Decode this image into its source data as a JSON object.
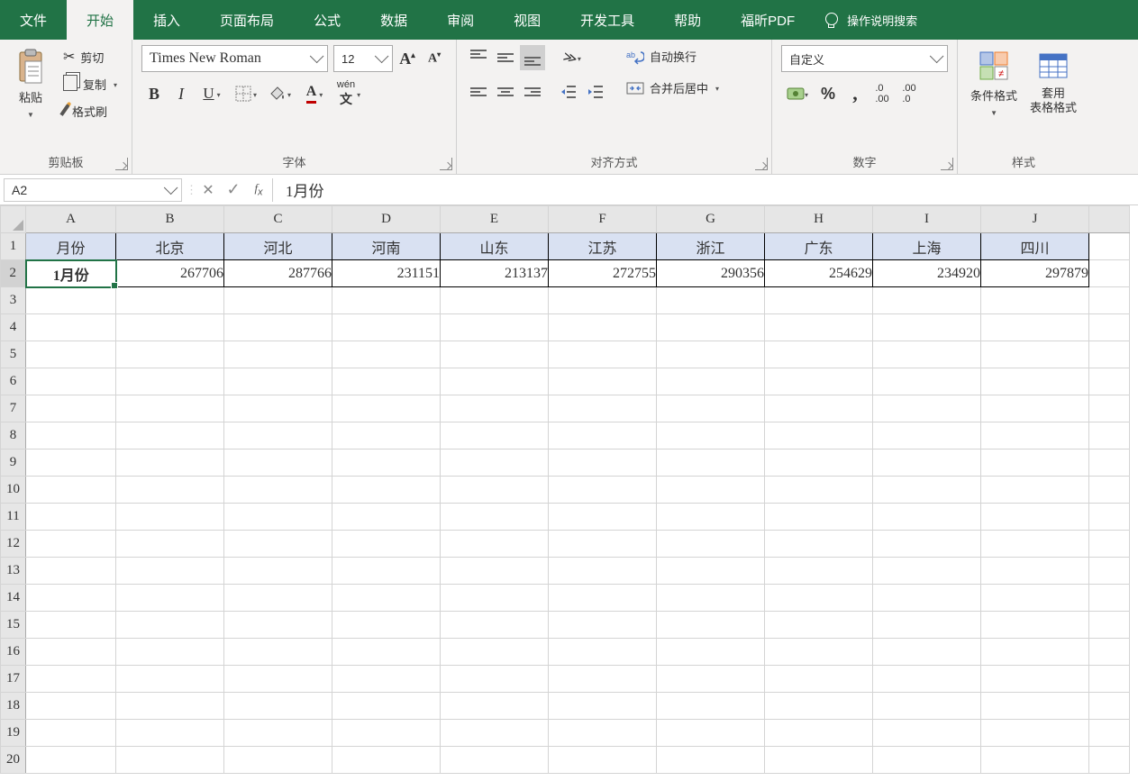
{
  "tabs": {
    "file": "文件",
    "home": "开始",
    "insert": "插入",
    "layout": "页面布局",
    "formula": "公式",
    "data": "数据",
    "review": "审阅",
    "view": "视图",
    "dev": "开发工具",
    "help": "帮助",
    "foxit": "福昕PDF",
    "tellme": "操作说明搜索"
  },
  "clipboard": {
    "label": "剪贴板",
    "paste": "粘贴",
    "cut": "剪切",
    "copy": "复制",
    "brush": "格式刷"
  },
  "font": {
    "label": "字体",
    "name": "Times New Roman",
    "size": "12",
    "pinyin": "wén"
  },
  "align": {
    "label": "对齐方式",
    "wrap": "自动换行",
    "merge": "合并后居中"
  },
  "number": {
    "label": "数字",
    "format": "自定义"
  },
  "styles": {
    "label": "样式",
    "condfmt": "条件格式",
    "tablefmt": "套用\n表格格式"
  },
  "namebox": "A2",
  "formula": "1月份",
  "columns": [
    "A",
    "B",
    "C",
    "D",
    "E",
    "F",
    "G",
    "H",
    "I",
    "J"
  ],
  "rows": [
    "1",
    "2",
    "3",
    "4",
    "5",
    "6",
    "7",
    "8",
    "9",
    "10",
    "11",
    "12",
    "13",
    "14",
    "15",
    "16",
    "17",
    "18",
    "19",
    "20"
  ],
  "data": {
    "headers": [
      "月份",
      "北京",
      "河北",
      "河南",
      "山东",
      "江苏",
      "浙江",
      "广东",
      "上海",
      "四川"
    ],
    "row2": [
      "1月份",
      "267706",
      "287766",
      "231151",
      "213137",
      "272755",
      "290356",
      "254629",
      "234920",
      "297879"
    ]
  }
}
